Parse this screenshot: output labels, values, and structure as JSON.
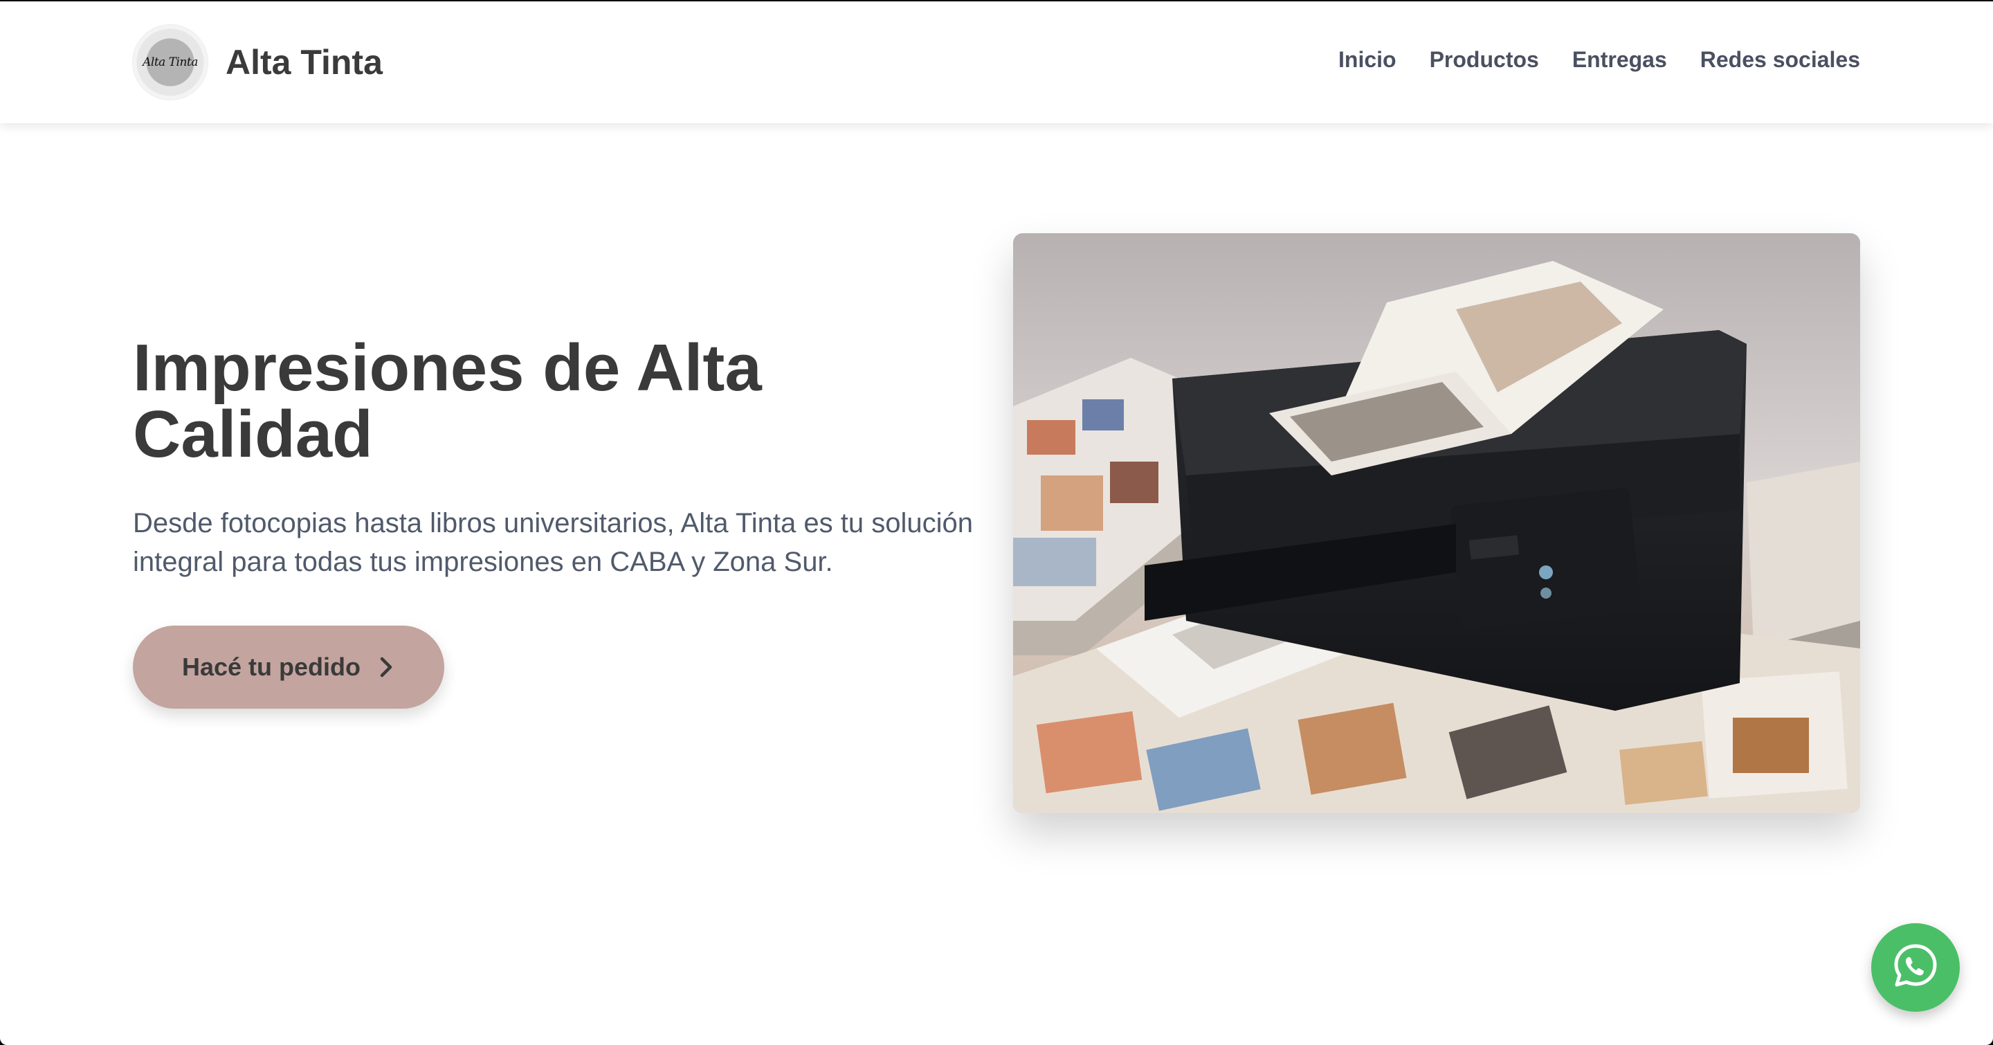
{
  "header": {
    "logo_text": "Alta Tinta",
    "brand_name": "Alta Tinta",
    "nav": [
      "Inicio",
      "Productos",
      "Entregas",
      "Redes sociales"
    ]
  },
  "hero": {
    "title": "Impresiones de Alta Calidad",
    "description": "Desde fotocopias hasta libros universitarios, Alta Tinta es tu solución integral para todas tus impresiones en CABA y Zona Sur.",
    "cta_label": "Hacé tu pedido",
    "cta_icon": "chevron-right-icon",
    "image_icon": "printer-photo"
  },
  "whatsapp": {
    "icon": "whatsapp-icon"
  },
  "colors": {
    "accent": "#c4a49e",
    "heading": "#3a3a3a",
    "text": "#505a6b",
    "nav": "#4a5061",
    "whatsapp": "#4bbf68"
  }
}
